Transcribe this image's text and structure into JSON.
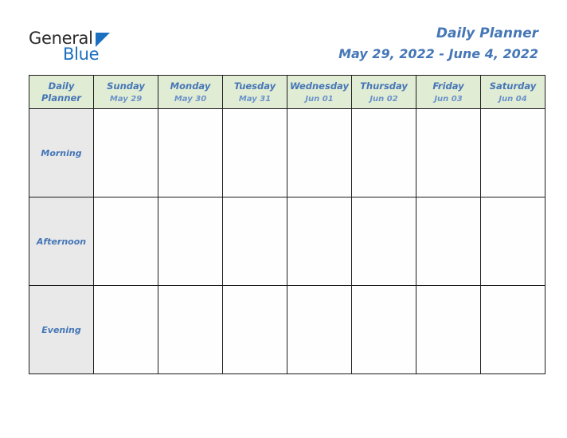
{
  "brand": {
    "line1": "General",
    "line2": "Blue",
    "triangle_icon": "triangle-icon",
    "color_dark": "#2b2b2b",
    "color_blue": "#1a6fc0"
  },
  "header": {
    "title": "Daily Planner",
    "date_range": "May 29, 2022 - June 4, 2022",
    "accent_color": "#4576b6"
  },
  "table": {
    "corner": {
      "line1": "Daily",
      "line2": "Planner"
    },
    "header_bg": "#e1ecd4",
    "label_bg": "#e9e9e9",
    "border_color": "#1c1c1c",
    "columns": [
      {
        "day": "Sunday",
        "date": "May 29"
      },
      {
        "day": "Monday",
        "date": "May 30"
      },
      {
        "day": "Tuesday",
        "date": "May 31"
      },
      {
        "day": "Wednesday",
        "date": "Jun 01"
      },
      {
        "day": "Thursday",
        "date": "Jun 02"
      },
      {
        "day": "Friday",
        "date": "Jun 03"
      },
      {
        "day": "Saturday",
        "date": "Jun 04"
      }
    ],
    "rows": [
      {
        "label": "Morning",
        "cells": [
          "",
          "",
          "",
          "",
          "",
          "",
          ""
        ]
      },
      {
        "label": "Afternoon",
        "cells": [
          "",
          "",
          "",
          "",
          "",
          "",
          ""
        ]
      },
      {
        "label": "Evening",
        "cells": [
          "",
          "",
          "",
          "",
          "",
          "",
          ""
        ]
      }
    ]
  }
}
